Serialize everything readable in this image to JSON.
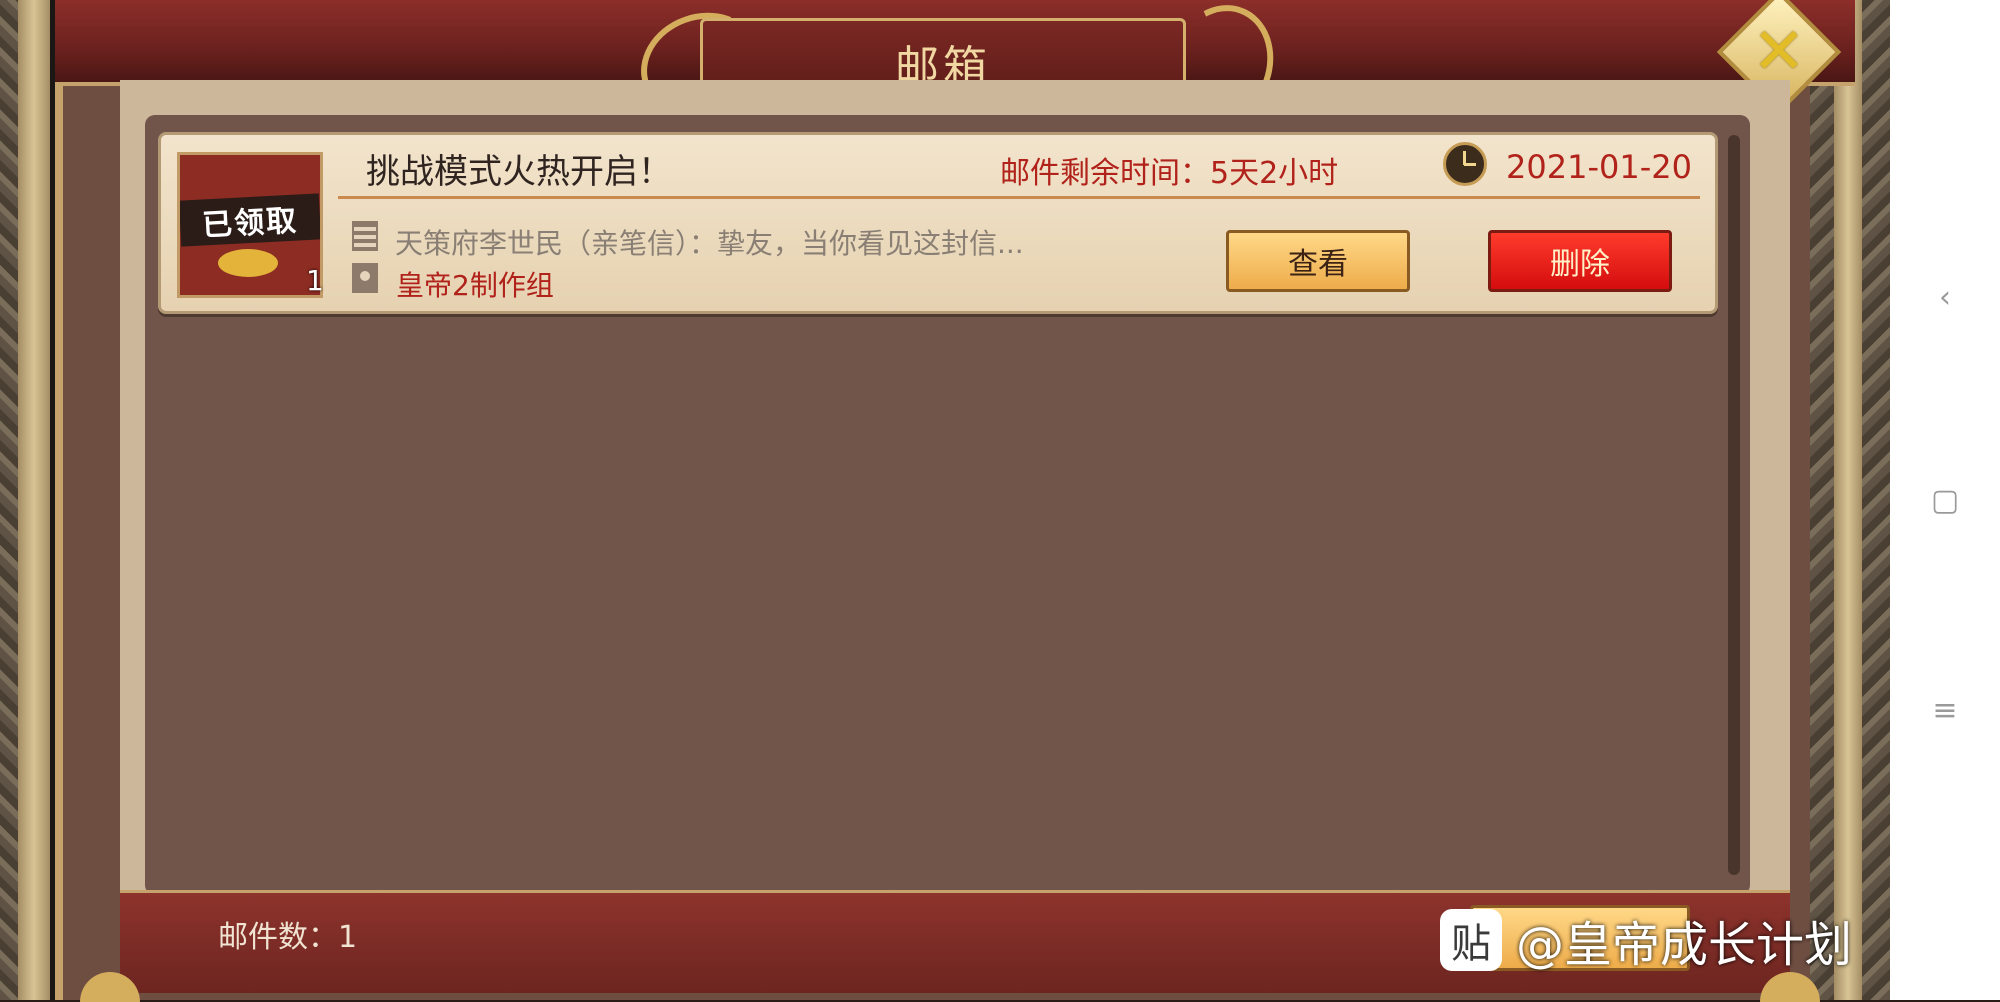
{
  "window": {
    "title": "邮箱"
  },
  "mail_list": {
    "items": [
      {
        "icon_label": "已领取",
        "item_count": "1",
        "title": "挑战模式火热开启！",
        "remaining": "邮件剩余时间：5天2小时",
        "date": "2021-01-20",
        "preview": "天策府李世民（亲笔信）：挚友，当你看见这封信...",
        "sender": "皇帝2制作组",
        "view_label": "查看",
        "delete_label": "删除"
      }
    ]
  },
  "footer": {
    "mail_count_label": "邮件数：1"
  },
  "watermark": {
    "logo_char": "贴",
    "text": "@皇帝成长计划"
  },
  "colors": {
    "accent_red": "#b1221b",
    "frame_red": "#8c2e2a",
    "gold": "#d4ad5d"
  },
  "icons": {
    "close": "close-icon",
    "clock": "clock-icon",
    "letter": "letter-icon",
    "sender": "sender-icon",
    "nav_back": "chevron-left-icon",
    "nav_home": "square-icon",
    "nav_menu": "menu-icon"
  }
}
